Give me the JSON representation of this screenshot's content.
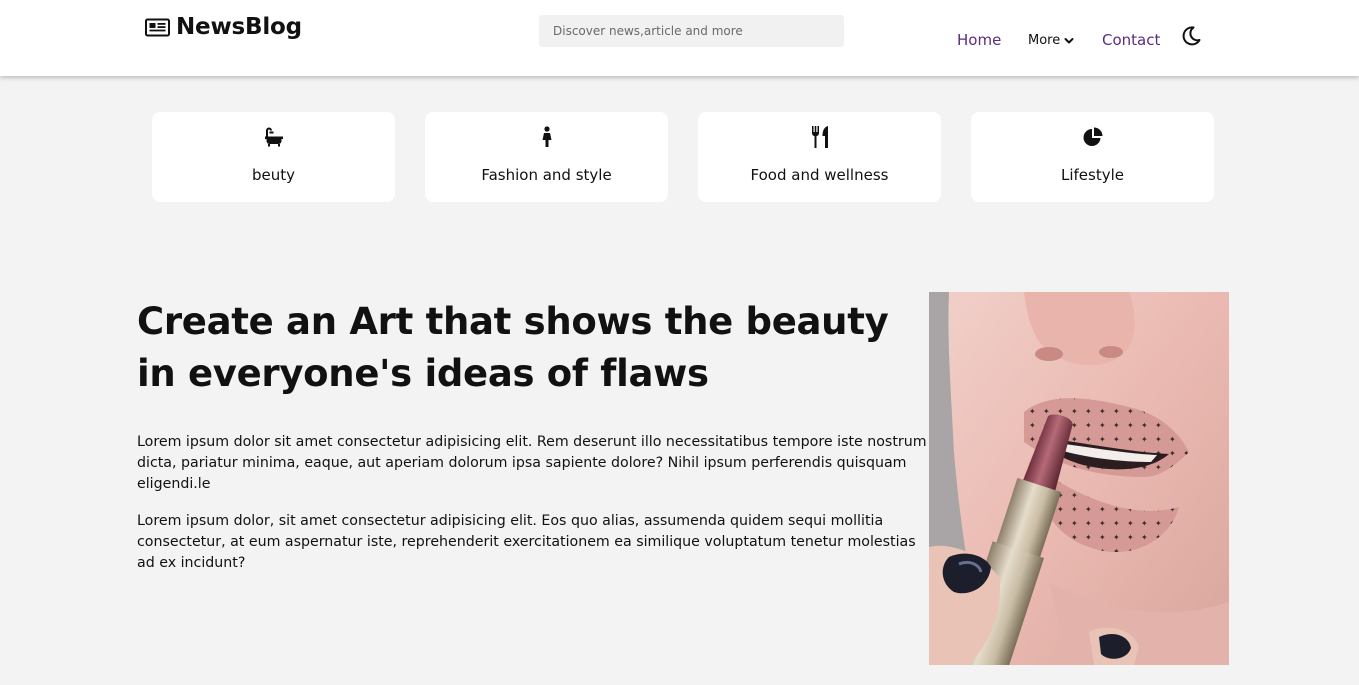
{
  "header": {
    "brand": "NewsBlog",
    "brand_icon": "newspaper-icon",
    "search_placeholder": "Discover news,article and more",
    "nav": {
      "home": "Home",
      "more": "More",
      "contact": "Contact"
    },
    "accent_color": "#5a2d82",
    "theme_icon": "moon-icon"
  },
  "categories": [
    {
      "label": "beuty",
      "icon": "bathtub-icon"
    },
    {
      "label": "Fashion and style",
      "icon": "female-figure-icon"
    },
    {
      "label": "Food and wellness",
      "icon": "utensils-icon"
    },
    {
      "label": "Lifestyle",
      "icon": "pie-chart-icon"
    }
  ],
  "article": {
    "title": "Create an Art that shows the beauty in everyone's ideas of flaws",
    "paragraphs": [
      "Lorem ipsum dolor sit amet consectetur adipisicing elit. Rem deserunt illo necessitatibus tempore iste nostrum dicta, pariatur minima, eaque, aut aperiam dolorum ipsa sapiente dolore? Nihil ipsum perferendis quisquam eligendi.le",
      "Lorem ipsum dolor, sit amet consectetur adipisicing elit. Eos quo alias, assumenda quidem sequi mollitia consectetur, at eum aspernatur iste, reprehenderit exercitationem ea similique voluptatum tenetur molestias ad ex incidunt?"
    ],
    "image": "lipstick-photo"
  }
}
